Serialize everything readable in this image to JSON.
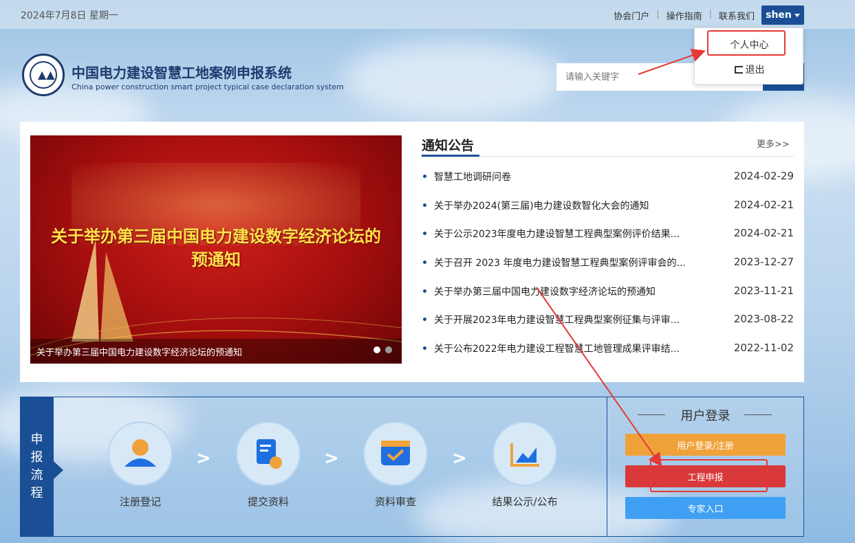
{
  "topbar": {
    "date": "2024年7月8日 星期一",
    "links": [
      "协会门户",
      "操作指南",
      "联系我们"
    ],
    "user": "shen"
  },
  "dropdown": {
    "personal_center": "个人中心",
    "logout": "退出"
  },
  "header": {
    "title": "中国电力建设智慧工地案例申报系统",
    "subtitle": "China power construction smart project typical case declaration system"
  },
  "search": {
    "placeholder": "请输入关键字"
  },
  "banner": {
    "headline_line1": "关于举办第三届中国电力建设数字经济论坛的",
    "headline_line2": "预通知",
    "caption": "关于举办第三届中国电力建设数字经济论坛的预通知"
  },
  "notices": {
    "title": "通知公告",
    "more": "更多>>",
    "items": [
      {
        "text": "智慧工地调研问卷",
        "date": "2024-02-29"
      },
      {
        "text": "关于举办2024(第三届)电力建设数智化大会的通知",
        "date": "2024-02-21"
      },
      {
        "text": "关于公示2023年度电力建设智慧工程典型案例评价结果...",
        "date": "2024-02-21"
      },
      {
        "text": "关于召开 2023 年度电力建设智慧工程典型案例评审会的...",
        "date": "2023-12-27"
      },
      {
        "text": "关于举办第三届中国电力建设数字经济论坛的预通知",
        "date": "2023-11-21"
      },
      {
        "text": "关于开展2023年电力建设智慧工程典型案例征集与评审...",
        "date": "2023-08-22"
      },
      {
        "text": "关于公布2022年电力建设工程智慧工地管理成果评审结...",
        "date": "2022-11-02"
      }
    ]
  },
  "process": {
    "label": "申报流程",
    "steps": [
      "注册登记",
      "提交资料",
      "资料审查",
      "结果公示/公布"
    ]
  },
  "login": {
    "title": "用户登录",
    "login_register": "用户登录/注册",
    "project_declare": "工程申报",
    "expert_entry": "专家入口"
  },
  "colors": {
    "primary": "#1a4f96",
    "orange": "#f0a23a",
    "red": "#d9393a",
    "blue": "#3fa0f3",
    "annotation": "#e53935"
  }
}
